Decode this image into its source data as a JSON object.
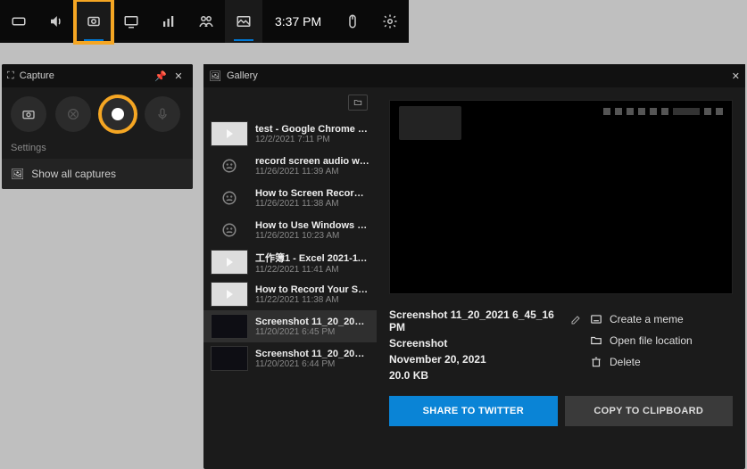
{
  "gamebar": {
    "time": "3:37 PM",
    "icons": [
      "xbox",
      "volume",
      "capture",
      "performance",
      "chart",
      "social",
      "gallery"
    ]
  },
  "capture": {
    "title": "Capture",
    "settings_label": "Settings",
    "show_all": "Show all captures"
  },
  "gallery": {
    "title": "Gallery",
    "items": [
      {
        "title": "test - Google Chrome 2021-1...",
        "sub": "12/2/2021 7:11 PM",
        "thumb": "light",
        "play": true
      },
      {
        "title": "record screen audio windo...",
        "sub": "11/26/2021 11:39 AM",
        "thumb": "none"
      },
      {
        "title": "How to Screen Record on W...",
        "sub": "11/26/2021 11:38 AM",
        "thumb": "none"
      },
      {
        "title": "How to Use Windows 10 Buil...",
        "sub": "11/26/2021 10:23 AM",
        "thumb": "none"
      },
      {
        "title": "工作簿1 - Excel 2021-11-22 11...",
        "sub": "11/22/2021 11:41 AM",
        "thumb": "light",
        "play": true
      },
      {
        "title": "How to Record Your Screen...",
        "sub": "11/22/2021 11:38 AM",
        "thumb": "light",
        "play": true
      },
      {
        "title": "Screenshot 11_20_2021 6_45...",
        "sub": "11/20/2021 6:45 PM",
        "thumb": "dark",
        "selected": true
      },
      {
        "title": "Screenshot 11_20_2021 6_44...",
        "sub": "11/20/2021 6:44 PM",
        "thumb": "dark"
      }
    ],
    "selected_meta": {
      "name": "Screenshot 11_20_2021 6_45_16 PM",
      "type": "Screenshot",
      "date": "November 20, 2021",
      "size": "20.0 KB"
    },
    "actions": {
      "meme": "Create a meme",
      "open": "Open file location",
      "delete": "Delete"
    },
    "buttons": {
      "twitter": "SHARE TO TWITTER",
      "copy": "COPY TO CLIPBOARD"
    }
  }
}
